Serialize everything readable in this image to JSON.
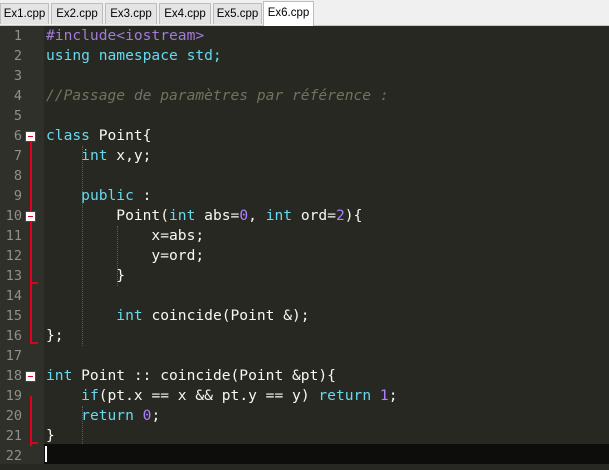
{
  "tabs": [
    {
      "label": "Ex1.cpp",
      "active": false
    },
    {
      "label": "Ex2.cpp",
      "active": false
    },
    {
      "label": "Ex3.cpp",
      "active": false
    },
    {
      "label": "Ex4.cpp",
      "active": false
    },
    {
      "label": "Ex5.cpp",
      "active": false
    },
    {
      "label": "Ex6.cpp",
      "active": true
    }
  ],
  "line_numbers": [
    "1",
    "2",
    "3",
    "4",
    "5",
    "6",
    "7",
    "8",
    "9",
    "10",
    "11",
    "12",
    "13",
    "14",
    "15",
    "16",
    "17",
    "18",
    "19",
    "20",
    "21",
    "22"
  ],
  "code": {
    "l1": "#include<iostream>",
    "l2": "using namespace std;",
    "l4": "//Passage de paramètres par référence :",
    "l6_kw": "class",
    "l6_rest": " Point{",
    "l7_ind": "    ",
    "l7_kw": "int",
    "l7_rest": " x,y;",
    "l9_ind": "    ",
    "l9_kw": "public",
    "l9_rest": " :",
    "l10_a": "        Point(",
    "l10_kw1": "int",
    "l10_b": " abs=",
    "l10_n1": "0",
    "l10_c": ", ",
    "l10_kw2": "int",
    "l10_d": " ord=",
    "l10_n2": "2",
    "l10_e": "){",
    "l11": "            x=abs;",
    "l12": "            y=ord;",
    "l13": "        }",
    "l15_ind": "        ",
    "l15_kw": "int",
    "l15_rest": " coincide(Point &);",
    "l16": "};",
    "l18_kw": "int",
    "l18_rest": " Point :: coincide(Point &pt){",
    "l19_ind": "    ",
    "l19_kw1": "if",
    "l19_a": "(pt.x == x && pt.y == y) ",
    "l19_kw2": "return",
    "l19_b": " ",
    "l19_n": "1",
    "l19_c": ";",
    "l20_ind": "    ",
    "l20_kw": "return",
    "l20_a": " ",
    "l20_n": "0",
    "l20_b": ";",
    "l21": "}"
  },
  "colors": {
    "background": "#272822",
    "keyword": "#66d9ef",
    "preprocessor": "#a27bd8",
    "comment": "#75715e",
    "number": "#ae81ff",
    "text": "#f8f8f2",
    "fold_marker": "#e0001a"
  }
}
